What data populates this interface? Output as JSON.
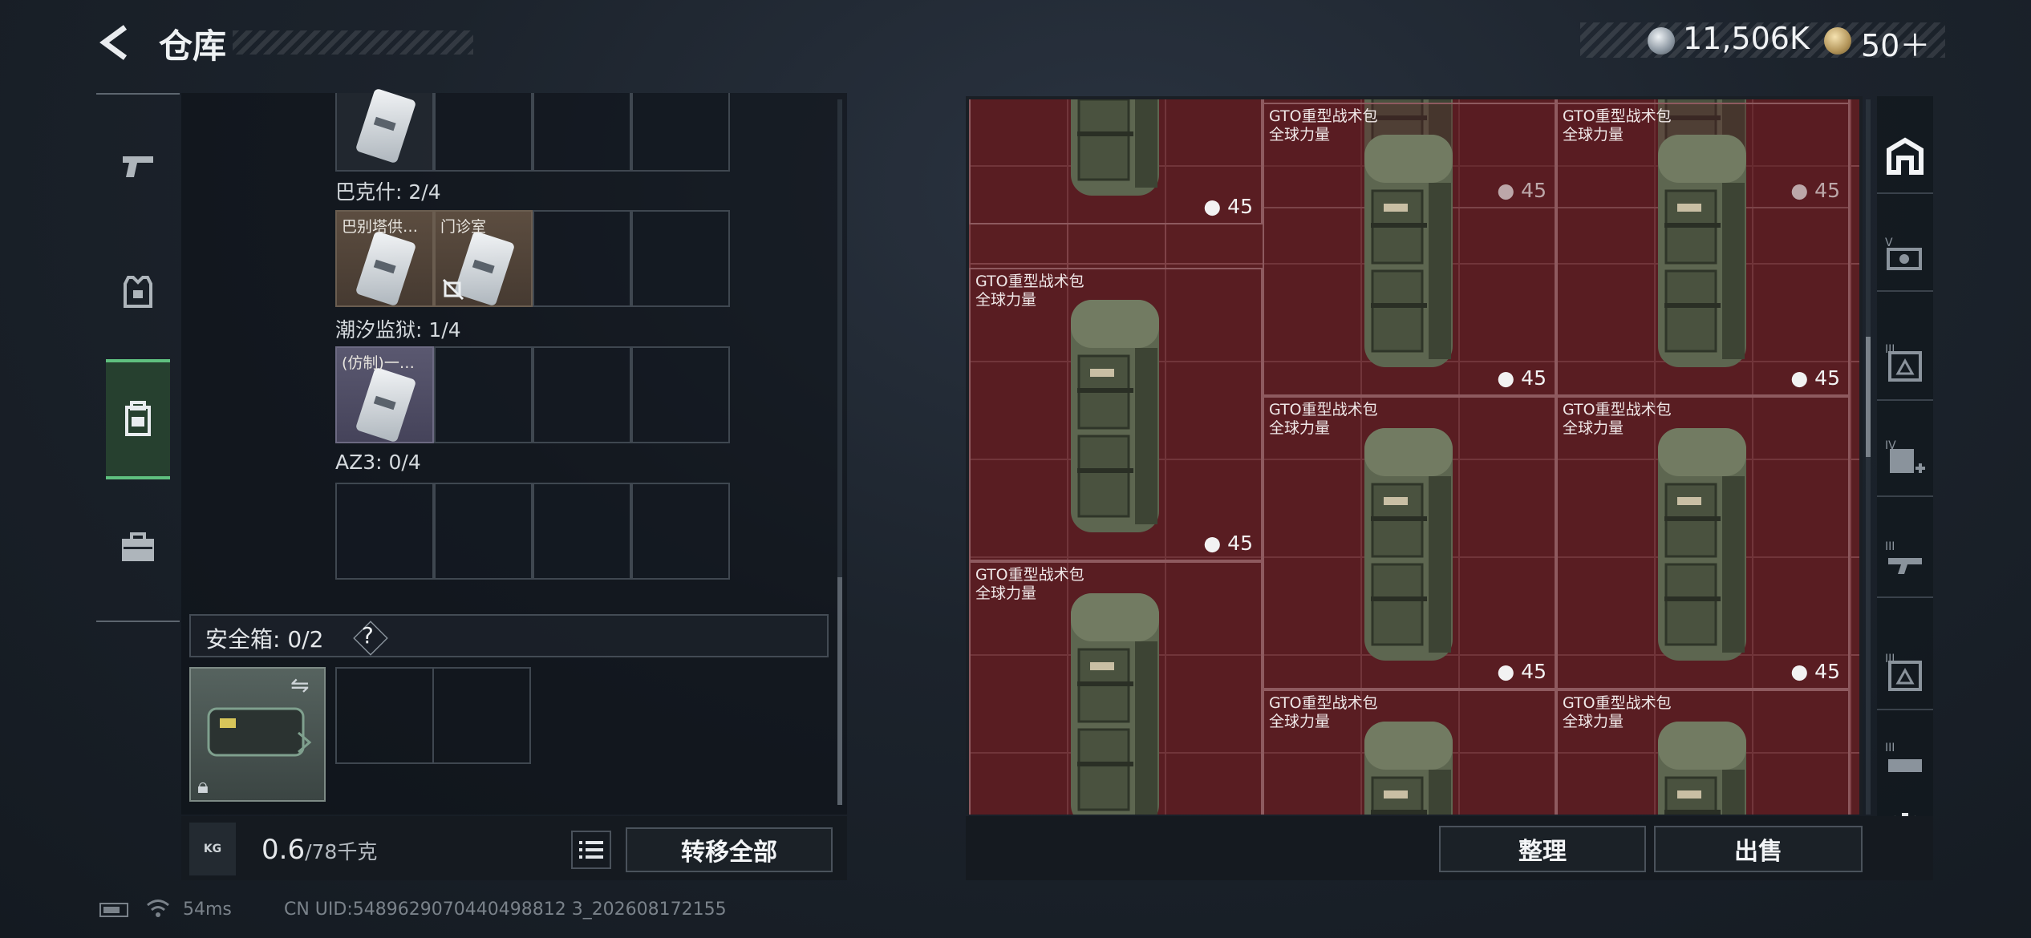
{
  "header": {
    "title": "仓库",
    "currency_silver": "11,506K",
    "currency_gold": "50＋"
  },
  "left_rail": {
    "items": [
      {
        "icon": "pistol-icon"
      },
      {
        "icon": "vest-icon"
      },
      {
        "icon": "backpack-icon",
        "active": true
      },
      {
        "icon": "briefcase-icon"
      }
    ]
  },
  "keys": {
    "groups": [
      {
        "label": "巴克什: 2/4",
        "slots": [
          "巴别塔供…",
          "门诊室",
          "",
          ""
        ]
      },
      {
        "label": "潮汐监狱: 1/4",
        "slots": [
          "(仿制)一…",
          "",
          "",
          ""
        ]
      },
      {
        "label": "AZ3: 0/4",
        "slots": [
          "",
          "",
          "",
          ""
        ]
      }
    ]
  },
  "safe_box": {
    "label": "安全箱: 0/2",
    "help": "?"
  },
  "weight": {
    "current": "0.6",
    "max": "/78千克",
    "kg_icon_text": "KG"
  },
  "buttons": {
    "transfer_all": "转移全部",
    "sort": "整理",
    "sell": "出售"
  },
  "stash": {
    "item_name_line1": "GTO重型战术包",
    "item_name_line2": "全球力量",
    "count": "45"
  },
  "status_bar": {
    "ping": "54ms",
    "uid": "CN UID:5489629070440498812 3_202608172155"
  },
  "colors": {
    "accent_green": "#5fc07f",
    "stash_bg": "#5a1e22"
  }
}
